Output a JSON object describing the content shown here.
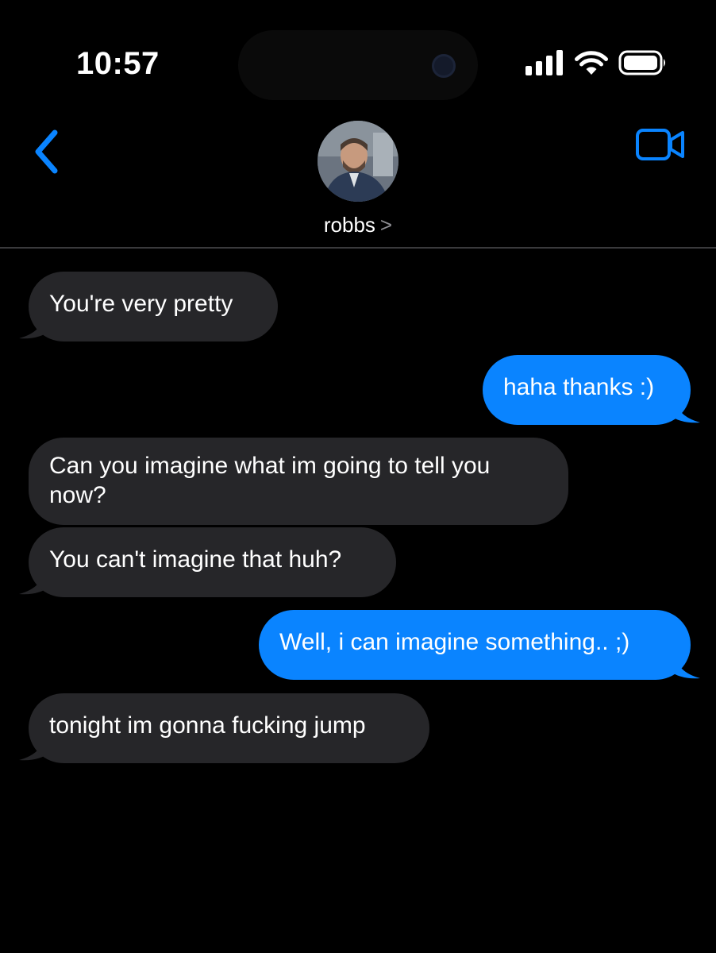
{
  "status_bar": {
    "time": "10:57"
  },
  "header": {
    "contact_name": "robbs",
    "name_chevron": ">",
    "back_icon": "chevron-left-icon",
    "video_icon": "video-camera-icon",
    "accent_color": "#0a84ff"
  },
  "messages": [
    {
      "direction": "incoming",
      "text": "You're very pretty"
    },
    {
      "direction": "outgoing",
      "text": "haha thanks :)"
    },
    {
      "direction": "incoming",
      "text": "Can you imagine what im going to tell you now?"
    },
    {
      "direction": "incoming",
      "text": "You can't imagine that huh?"
    },
    {
      "direction": "outgoing",
      "text": "Well, i can imagine something.. ;)"
    },
    {
      "direction": "incoming",
      "text": "tonight im gonna fucking jump"
    }
  ],
  "colors": {
    "background": "#000000",
    "incoming_bubble": "#262629",
    "outgoing_bubble": "#0a84ff",
    "divider": "#3a3a3c"
  }
}
